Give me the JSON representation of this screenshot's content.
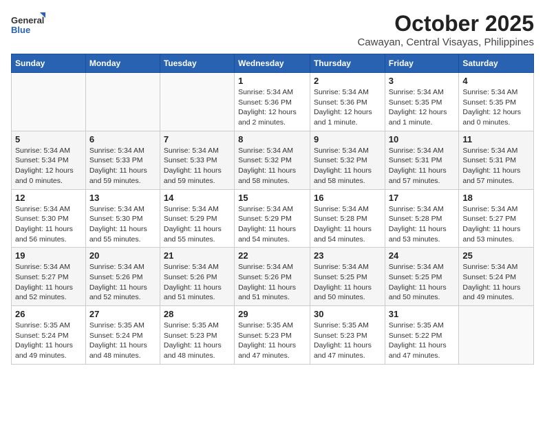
{
  "header": {
    "logo_line1": "General",
    "logo_line2": "Blue",
    "month": "October 2025",
    "location": "Cawayan, Central Visayas, Philippines"
  },
  "weekdays": [
    "Sunday",
    "Monday",
    "Tuesday",
    "Wednesday",
    "Thursday",
    "Friday",
    "Saturday"
  ],
  "weeks": [
    [
      {
        "day": "",
        "info": ""
      },
      {
        "day": "",
        "info": ""
      },
      {
        "day": "",
        "info": ""
      },
      {
        "day": "1",
        "info": "Sunrise: 5:34 AM\nSunset: 5:36 PM\nDaylight: 12 hours\nand 2 minutes."
      },
      {
        "day": "2",
        "info": "Sunrise: 5:34 AM\nSunset: 5:36 PM\nDaylight: 12 hours\nand 1 minute."
      },
      {
        "day": "3",
        "info": "Sunrise: 5:34 AM\nSunset: 5:35 PM\nDaylight: 12 hours\nand 1 minute."
      },
      {
        "day": "4",
        "info": "Sunrise: 5:34 AM\nSunset: 5:35 PM\nDaylight: 12 hours\nand 0 minutes."
      }
    ],
    [
      {
        "day": "5",
        "info": "Sunrise: 5:34 AM\nSunset: 5:34 PM\nDaylight: 12 hours\nand 0 minutes."
      },
      {
        "day": "6",
        "info": "Sunrise: 5:34 AM\nSunset: 5:33 PM\nDaylight: 11 hours\nand 59 minutes."
      },
      {
        "day": "7",
        "info": "Sunrise: 5:34 AM\nSunset: 5:33 PM\nDaylight: 11 hours\nand 59 minutes."
      },
      {
        "day": "8",
        "info": "Sunrise: 5:34 AM\nSunset: 5:32 PM\nDaylight: 11 hours\nand 58 minutes."
      },
      {
        "day": "9",
        "info": "Sunrise: 5:34 AM\nSunset: 5:32 PM\nDaylight: 11 hours\nand 58 minutes."
      },
      {
        "day": "10",
        "info": "Sunrise: 5:34 AM\nSunset: 5:31 PM\nDaylight: 11 hours\nand 57 minutes."
      },
      {
        "day": "11",
        "info": "Sunrise: 5:34 AM\nSunset: 5:31 PM\nDaylight: 11 hours\nand 57 minutes."
      }
    ],
    [
      {
        "day": "12",
        "info": "Sunrise: 5:34 AM\nSunset: 5:30 PM\nDaylight: 11 hours\nand 56 minutes."
      },
      {
        "day": "13",
        "info": "Sunrise: 5:34 AM\nSunset: 5:30 PM\nDaylight: 11 hours\nand 55 minutes."
      },
      {
        "day": "14",
        "info": "Sunrise: 5:34 AM\nSunset: 5:29 PM\nDaylight: 11 hours\nand 55 minutes."
      },
      {
        "day": "15",
        "info": "Sunrise: 5:34 AM\nSunset: 5:29 PM\nDaylight: 11 hours\nand 54 minutes."
      },
      {
        "day": "16",
        "info": "Sunrise: 5:34 AM\nSunset: 5:28 PM\nDaylight: 11 hours\nand 54 minutes."
      },
      {
        "day": "17",
        "info": "Sunrise: 5:34 AM\nSunset: 5:28 PM\nDaylight: 11 hours\nand 53 minutes."
      },
      {
        "day": "18",
        "info": "Sunrise: 5:34 AM\nSunset: 5:27 PM\nDaylight: 11 hours\nand 53 minutes."
      }
    ],
    [
      {
        "day": "19",
        "info": "Sunrise: 5:34 AM\nSunset: 5:27 PM\nDaylight: 11 hours\nand 52 minutes."
      },
      {
        "day": "20",
        "info": "Sunrise: 5:34 AM\nSunset: 5:26 PM\nDaylight: 11 hours\nand 52 minutes."
      },
      {
        "day": "21",
        "info": "Sunrise: 5:34 AM\nSunset: 5:26 PM\nDaylight: 11 hours\nand 51 minutes."
      },
      {
        "day": "22",
        "info": "Sunrise: 5:34 AM\nSunset: 5:26 PM\nDaylight: 11 hours\nand 51 minutes."
      },
      {
        "day": "23",
        "info": "Sunrise: 5:34 AM\nSunset: 5:25 PM\nDaylight: 11 hours\nand 50 minutes."
      },
      {
        "day": "24",
        "info": "Sunrise: 5:34 AM\nSunset: 5:25 PM\nDaylight: 11 hours\nand 50 minutes."
      },
      {
        "day": "25",
        "info": "Sunrise: 5:34 AM\nSunset: 5:24 PM\nDaylight: 11 hours\nand 49 minutes."
      }
    ],
    [
      {
        "day": "26",
        "info": "Sunrise: 5:35 AM\nSunset: 5:24 PM\nDaylight: 11 hours\nand 49 minutes."
      },
      {
        "day": "27",
        "info": "Sunrise: 5:35 AM\nSunset: 5:24 PM\nDaylight: 11 hours\nand 48 minutes."
      },
      {
        "day": "28",
        "info": "Sunrise: 5:35 AM\nSunset: 5:23 PM\nDaylight: 11 hours\nand 48 minutes."
      },
      {
        "day": "29",
        "info": "Sunrise: 5:35 AM\nSunset: 5:23 PM\nDaylight: 11 hours\nand 47 minutes."
      },
      {
        "day": "30",
        "info": "Sunrise: 5:35 AM\nSunset: 5:23 PM\nDaylight: 11 hours\nand 47 minutes."
      },
      {
        "day": "31",
        "info": "Sunrise: 5:35 AM\nSunset: 5:22 PM\nDaylight: 11 hours\nand 47 minutes."
      },
      {
        "day": "",
        "info": ""
      }
    ]
  ]
}
